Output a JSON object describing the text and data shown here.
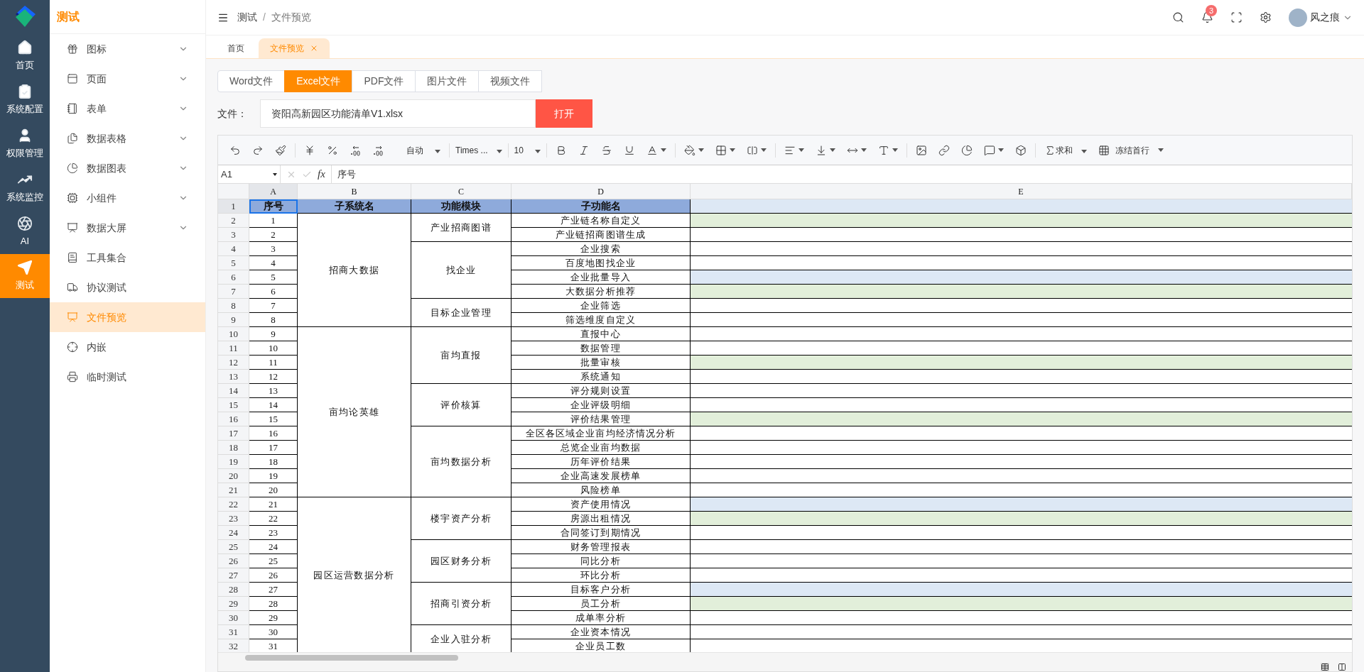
{
  "rail": {
    "items": [
      {
        "label": "首页",
        "selected": false
      },
      {
        "label": "系统配置",
        "selected": false
      },
      {
        "label": "权限管理",
        "selected": false
      },
      {
        "label": "系统监控",
        "selected": false
      },
      {
        "label": "AI",
        "selected": false
      },
      {
        "label": "测试",
        "selected": true
      }
    ]
  },
  "sidebar": {
    "title": "测试",
    "items": [
      {
        "label": "图标",
        "expandable": true,
        "selected": false
      },
      {
        "label": "页面",
        "expandable": true,
        "selected": false
      },
      {
        "label": "表单",
        "expandable": true,
        "selected": false
      },
      {
        "label": "数据表格",
        "expandable": true,
        "selected": false
      },
      {
        "label": "数据图表",
        "expandable": true,
        "selected": false
      },
      {
        "label": "小组件",
        "expandable": true,
        "selected": false
      },
      {
        "label": "数据大屏",
        "expandable": true,
        "selected": false
      },
      {
        "label": "工具集合",
        "expandable": false,
        "selected": false
      },
      {
        "label": "协议测试",
        "expandable": false,
        "selected": false
      },
      {
        "label": "文件预览",
        "expandable": false,
        "selected": true
      },
      {
        "label": "内嵌",
        "expandable": false,
        "selected": false
      },
      {
        "label": "临时测试",
        "expandable": false,
        "selected": false
      }
    ]
  },
  "header": {
    "breadcrumb": [
      "测试",
      "文件预览"
    ],
    "separator": "/",
    "notifications": "3",
    "user": "风之痕"
  },
  "page_tabs": [
    {
      "label": "首页",
      "selected": false,
      "closable": false
    },
    {
      "label": "文件预览",
      "selected": true,
      "closable": true
    }
  ],
  "file_types": [
    {
      "label": "Word文件",
      "selected": false
    },
    {
      "label": "Excel文件",
      "selected": true
    },
    {
      "label": "PDF文件",
      "selected": false
    },
    {
      "label": "图片文件",
      "selected": false
    },
    {
      "label": "视频文件",
      "selected": false
    }
  ],
  "file": {
    "label": "文件：",
    "value": "资阳高新园区功能清单V1.xlsx",
    "button": "打开"
  },
  "toolbar": {
    "number_format": "自动",
    "font": "Times ...",
    "size": "10",
    "sum": "求和",
    "freeze": "冻结首行"
  },
  "formula_bar": {
    "cell": "A1",
    "fx": "fx",
    "value": "序号"
  },
  "sheet": {
    "columns": [
      "A",
      "B",
      "C",
      "D",
      "E"
    ],
    "header": {
      "row": "1",
      "color": "#dde8f5",
      "cells": [
        {
          "text": "序号",
          "selected": true
        },
        {
          "text": "子系统名",
          "selected": false
        },
        {
          "text": "功能模块",
          "selected": false
        },
        {
          "text": "子功能名",
          "selected": false
        }
      ]
    },
    "groups": [
      {
        "name": "招商大数据",
        "modules": [
          {
            "name": "产业招商图谱",
            "functions": [
              {
                "row": "2",
                "no": "1",
                "name": "产业链名称自定义",
                "color": "#e2efda"
              },
              {
                "row": "3",
                "no": "2",
                "name": "产业链招商图谱生成"
              }
            ]
          },
          {
            "name": "找企业",
            "functions": [
              {
                "row": "4",
                "no": "3",
                "name": "企业搜索"
              },
              {
                "row": "5",
                "no": "4",
                "name": "百度地图找企业"
              },
              {
                "row": "6",
                "no": "5",
                "name": "企业批量导入",
                "color": "#dde8f5"
              },
              {
                "row": "7",
                "no": "6",
                "name": "大数据分析推荐",
                "color": "#e2efda"
              }
            ]
          },
          {
            "name": "目标企业管理",
            "functions": [
              {
                "row": "8",
                "no": "7",
                "name": "企业筛选"
              },
              {
                "row": "9",
                "no": "8",
                "name": "筛选维度自定义"
              }
            ]
          }
        ]
      },
      {
        "name": "亩均论英雄",
        "modules": [
          {
            "name": "亩均直报",
            "functions": [
              {
                "row": "10",
                "no": "9",
                "name": "直报中心"
              },
              {
                "row": "11",
                "no": "10",
                "name": "数据管理"
              },
              {
                "row": "12",
                "no": "11",
                "name": "批量审核",
                "color": "#e2efda"
              },
              {
                "row": "13",
                "no": "12",
                "name": "系统通知"
              }
            ]
          },
          {
            "name": "评价核算",
            "functions": [
              {
                "row": "14",
                "no": "13",
                "name": "评分规则设置"
              },
              {
                "row": "15",
                "no": "14",
                "name": "企业评级明细"
              },
              {
                "row": "16",
                "no": "15",
                "name": "评价结果管理",
                "color": "#e2efda"
              }
            ]
          },
          {
            "name": "亩均数据分析",
            "functions": [
              {
                "row": "17",
                "no": "16",
                "name": "全区各区域企业亩均经济情况分析"
              },
              {
                "row": "18",
                "no": "17",
                "name": "总览企业亩均数据"
              },
              {
                "row": "19",
                "no": "18",
                "name": "历年评价结果"
              },
              {
                "row": "20",
                "no": "19",
                "name": "企业高速发展榜单"
              },
              {
                "row": "21",
                "no": "20",
                "name": "风险榜单"
              }
            ]
          }
        ]
      },
      {
        "name": "园区运营数据分析",
        "modules": [
          {
            "name": "楼宇资产分析",
            "functions": [
              {
                "row": "22",
                "no": "21",
                "name": "资产使用情况",
                "color": "#dde8f5"
              },
              {
                "row": "23",
                "no": "22",
                "name": "房源出租情况",
                "color": "#e2efda"
              },
              {
                "row": "24",
                "no": "23",
                "name": "合同签订到期情况"
              }
            ]
          },
          {
            "name": "园区财务分析",
            "functions": [
              {
                "row": "25",
                "no": "24",
                "name": "财务管理报表"
              },
              {
                "row": "26",
                "no": "25",
                "name": "同比分析"
              },
              {
                "row": "27",
                "no": "26",
                "name": "环比分析"
              }
            ]
          },
          {
            "name": "招商引资分析",
            "functions": [
              {
                "row": "28",
                "no": "27",
                "name": "目标客户分析",
                "color": "#dde8f5"
              },
              {
                "row": "29",
                "no": "28",
                "name": "员工分析",
                "color": "#e2efda"
              },
              {
                "row": "30",
                "no": "29",
                "name": "成单率分析"
              }
            ]
          },
          {
            "name": "企业入驻分析",
            "functions": [
              {
                "row": "31",
                "no": "30",
                "name": "企业资本情况"
              },
              {
                "row": "32",
                "no": "31",
                "name": "企业员工数"
              }
            ]
          }
        ]
      }
    ]
  }
}
